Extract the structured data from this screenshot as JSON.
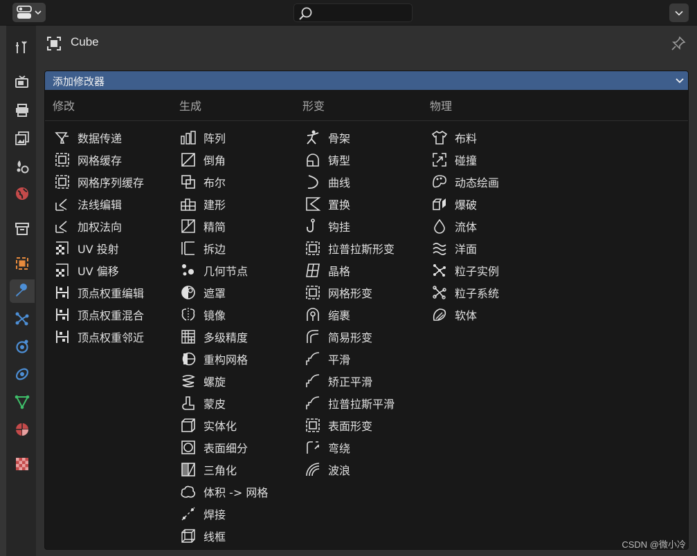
{
  "object": {
    "name": "Cube"
  },
  "menu": {
    "title": "添加修改器"
  },
  "columns": [
    {
      "heading": "修改",
      "items": [
        {
          "label": "数据传递",
          "icon": "data-transfer-icon"
        },
        {
          "label": "网格缓存",
          "icon": "mesh-cache-icon"
        },
        {
          "label": "网格序列缓存",
          "icon": "mesh-sequence-cache-icon"
        },
        {
          "label": "法线编辑",
          "icon": "normal-edit-icon"
        },
        {
          "label": "加权法向",
          "icon": "weighted-normal-icon"
        },
        {
          "label": "UV 投射",
          "icon": "uv-project-icon"
        },
        {
          "label": "UV 偏移",
          "icon": "uv-warp-icon"
        },
        {
          "label": "顶点权重编辑",
          "icon": "vertex-weight-edit-icon"
        },
        {
          "label": "顶点权重混合",
          "icon": "vertex-weight-mix-icon"
        },
        {
          "label": "顶点权重邻近",
          "icon": "vertex-weight-proximity-icon"
        }
      ]
    },
    {
      "heading": "生成",
      "items": [
        {
          "label": "阵列",
          "icon": "array-icon"
        },
        {
          "label": "倒角",
          "icon": "bevel-icon"
        },
        {
          "label": "布尔",
          "icon": "boolean-icon"
        },
        {
          "label": "建形",
          "icon": "build-icon"
        },
        {
          "label": "精简",
          "icon": "decimate-icon"
        },
        {
          "label": "拆边",
          "icon": "edge-split-icon"
        },
        {
          "label": "几何节点",
          "icon": "geometry-nodes-icon"
        },
        {
          "label": "遮罩",
          "icon": "mask-icon"
        },
        {
          "label": "镜像",
          "icon": "mirror-icon"
        },
        {
          "label": "多级精度",
          "icon": "multires-icon"
        },
        {
          "label": "重构网格",
          "icon": "remesh-icon"
        },
        {
          "label": "螺旋",
          "icon": "screw-icon"
        },
        {
          "label": "蒙皮",
          "icon": "skin-icon"
        },
        {
          "label": "实体化",
          "icon": "solidify-icon"
        },
        {
          "label": "表面细分",
          "icon": "subdivision-surface-icon"
        },
        {
          "label": "三角化",
          "icon": "triangulate-icon"
        },
        {
          "label": "体积 -> 网格",
          "icon": "volume-to-mesh-icon"
        },
        {
          "label": "焊接",
          "icon": "weld-icon"
        },
        {
          "label": "线框",
          "icon": "wireframe-icon"
        }
      ]
    },
    {
      "heading": "形变",
      "items": [
        {
          "label": "骨架",
          "icon": "armature-icon"
        },
        {
          "label": "铸型",
          "icon": "cast-icon"
        },
        {
          "label": "曲线",
          "icon": "curve-icon"
        },
        {
          "label": "置换",
          "icon": "displace-icon"
        },
        {
          "label": "钩挂",
          "icon": "hook-icon"
        },
        {
          "label": "拉普拉斯形变",
          "icon": "laplacian-deform-icon"
        },
        {
          "label": "晶格",
          "icon": "lattice-icon"
        },
        {
          "label": "网格形变",
          "icon": "mesh-deform-icon"
        },
        {
          "label": "缩裹",
          "icon": "shrinkwrap-icon"
        },
        {
          "label": "简易形变",
          "icon": "simple-deform-icon"
        },
        {
          "label": "平滑",
          "icon": "smooth-icon"
        },
        {
          "label": "矫正平滑",
          "icon": "corrective-smooth-icon"
        },
        {
          "label": "拉普拉斯平滑",
          "icon": "laplacian-smooth-icon"
        },
        {
          "label": "表面形变",
          "icon": "surface-deform-icon"
        },
        {
          "label": "弯绕",
          "icon": "warp-icon"
        },
        {
          "label": "波浪",
          "icon": "wave-icon"
        }
      ]
    },
    {
      "heading": "物理",
      "items": [
        {
          "label": "布料",
          "icon": "cloth-icon"
        },
        {
          "label": "碰撞",
          "icon": "collision-icon"
        },
        {
          "label": "动态绘画",
          "icon": "dynamic-paint-icon"
        },
        {
          "label": "爆破",
          "icon": "explode-icon"
        },
        {
          "label": "流体",
          "icon": "fluid-icon"
        },
        {
          "label": "洋面",
          "icon": "ocean-icon"
        },
        {
          "label": "粒子实例",
          "icon": "particle-instance-icon"
        },
        {
          "label": "粒子系统",
          "icon": "particle-system-icon"
        },
        {
          "label": "软体",
          "icon": "soft-body-icon"
        }
      ]
    }
  ],
  "properties_tabs": [
    {
      "icon": "tool-icon",
      "active": false
    },
    {
      "icon": "render-icon",
      "active": false
    },
    {
      "icon": "output-icon",
      "active": false
    },
    {
      "icon": "view-layer-icon",
      "active": false
    },
    {
      "icon": "scene-icon",
      "active": false
    },
    {
      "icon": "world-icon",
      "active": false
    },
    {
      "icon": "collection-icon",
      "active": false
    },
    {
      "icon": "object-icon",
      "active": false
    },
    {
      "icon": "modifier-wrench-icon",
      "active": true
    },
    {
      "icon": "particles-icon",
      "active": false
    },
    {
      "icon": "physics-icon",
      "active": false
    },
    {
      "icon": "constraints-icon",
      "active": false
    },
    {
      "icon": "object-data-icon",
      "active": false
    },
    {
      "icon": "material-icon",
      "active": false
    },
    {
      "icon": "texture-icon",
      "active": false
    }
  ],
  "watermark": "CSDN @微小冷",
  "colors": {
    "menu_header": "#3e5e8c",
    "menu_bg": "#181818",
    "panel_bg": "#303030"
  }
}
